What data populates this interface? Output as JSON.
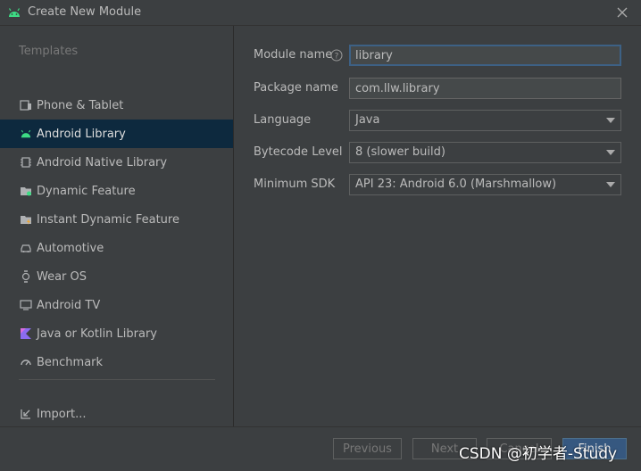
{
  "window": {
    "title": "Create New Module",
    "title_icon": "android-icon",
    "close_icon": "close-icon"
  },
  "sidebar": {
    "header": "Templates",
    "items": [
      {
        "label": "Phone & Tablet",
        "icon": "phone-tablet-icon",
        "selected": false
      },
      {
        "label": "Android Library",
        "icon": "android-icon",
        "selected": true
      },
      {
        "label": "Android Native Library",
        "icon": "chip-icon",
        "selected": false
      },
      {
        "label": "Dynamic Feature",
        "icon": "folder-feature-icon",
        "selected": false
      },
      {
        "label": "Instant Dynamic Feature",
        "icon": "folder-instant-icon",
        "selected": false
      },
      {
        "label": "Automotive",
        "icon": "car-icon",
        "selected": false
      },
      {
        "label": "Wear OS",
        "icon": "watch-icon",
        "selected": false
      },
      {
        "label": "Android TV",
        "icon": "tv-icon",
        "selected": false
      },
      {
        "label": "Java or Kotlin Library",
        "icon": "kotlin-icon",
        "selected": false
      },
      {
        "label": "Benchmark",
        "icon": "gauge-icon",
        "selected": false
      }
    ],
    "import": {
      "label": "Import...",
      "icon": "import-icon"
    }
  },
  "form": {
    "module_name": {
      "label": "Module name",
      "value": "library"
    },
    "package_name": {
      "label": "Package name",
      "value": "com.llw.library"
    },
    "language": {
      "label": "Language",
      "value": "Java"
    },
    "bytecode_level": {
      "label": "Bytecode Level",
      "value": "8 (slower build)"
    },
    "minimum_sdk": {
      "label": "Minimum SDK",
      "value": "API 23: Android 6.0 (Marshmallow)"
    }
  },
  "footer": {
    "previous": "Previous",
    "next": "Next",
    "cancel": "Cancel",
    "finish": "Finish"
  },
  "watermark": "CSDN @初学者-Study",
  "colors": {
    "accent": "#365880",
    "selection": "#0d293e",
    "android_green": "#3ddc84"
  }
}
